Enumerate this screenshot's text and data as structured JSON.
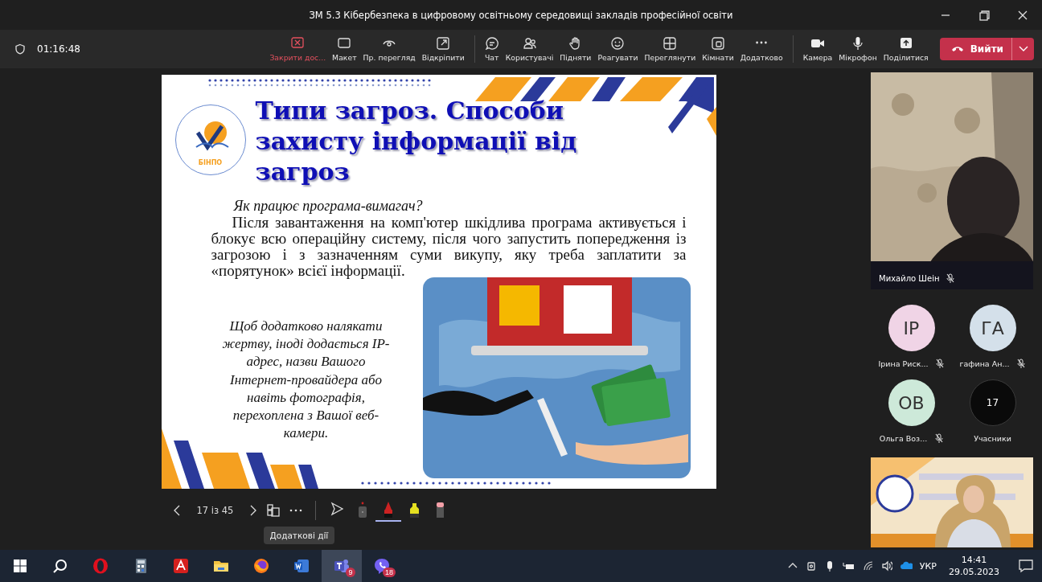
{
  "window": {
    "title": "ЗМ 5.3 Кібербезпека в цифровому освітньому середовищі закладів професійної освіти"
  },
  "meeting_toolbar": {
    "timer": "01:16:48",
    "buttons": [
      {
        "label": "Закрити дос...",
        "danger": true
      },
      {
        "label": "Макет",
        "danger": false
      },
      {
        "label": "Пр. перегляд",
        "danger": false
      },
      {
        "label": "Відкріпити",
        "danger": false
      },
      {
        "label": "Чат",
        "danger": false
      },
      {
        "label": "Користувачі",
        "danger": false
      },
      {
        "label": "Підняти",
        "danger": false
      },
      {
        "label": "Реагувати",
        "danger": false
      },
      {
        "label": "Переглянути",
        "danger": false
      },
      {
        "label": "Кімнати",
        "danger": false
      },
      {
        "label": "Додатково",
        "danger": false
      },
      {
        "label": "Камера",
        "danger": false
      },
      {
        "label": "Мікрофон",
        "danger": false
      },
      {
        "label": "Поділитися",
        "danger": false
      }
    ],
    "leave_button": {
      "label": "Вийти"
    }
  },
  "slide": {
    "logo_text": "БІНПО",
    "title": "Типи загроз. Способи захисту інформації від загроз",
    "question": "Як працює програма-вимагач?",
    "paragraph": "Після завантаження на комп'ютер шкідлива програма активується і блокує всю операційну систему, після чого запустить попередження із загрозою і з зазначенням суми викупу, яку треба заплатити за «порятунок» всієї інформації.",
    "side_text": "Щоб додатково налякати жертву, іноді додається IP-адрес, назви Вашого Інтернет-провайдера або навіть фотографія, перехоплена з Вашої веб-камери."
  },
  "slide_controls": {
    "counter": "17 із 45",
    "tooltip": "Додаткові дії",
    "tools": [
      {
        "kind": "pointer",
        "selected": false
      },
      {
        "kind": "laser",
        "selected": false
      },
      {
        "kind": "pen",
        "selected": true
      },
      {
        "kind": "highlighter",
        "selected": false
      },
      {
        "kind": "eraser",
        "selected": false
      }
    ]
  },
  "participants": {
    "main_video": {
      "kind": "picture",
      "name": "Михайло Шеін",
      "muted": true
    },
    "avatars": [
      {
        "initials": "ІР",
        "name": "Ірина Риск...",
        "color": "#f0d4e6",
        "muted": true
      },
      {
        "initials": "ГА",
        "name": "гафина Ан...",
        "color": "#d4e0ea",
        "muted": true
      },
      {
        "initials": "ОВ",
        "name": "Ольга Воз...",
        "color": "#cde9d9",
        "muted": true
      }
    ],
    "overflow": {
      "count": "17",
      "label": "Учасники"
    }
  },
  "taskbar": {
    "apps": [
      {
        "kind": "search",
        "active": false
      },
      {
        "kind": "opera",
        "active": false
      },
      {
        "kind": "calculator",
        "active": false
      },
      {
        "kind": "acrobat",
        "active": false
      },
      {
        "kind": "explorer",
        "active": false
      },
      {
        "kind": "firefox",
        "active": false
      },
      {
        "kind": "word",
        "active": false
      },
      {
        "kind": "teams",
        "active": true,
        "badge": "9"
      },
      {
        "kind": "viber",
        "active": false,
        "badge": "18"
      }
    ],
    "language": "УКР",
    "time": "14:41",
    "date": "29.05.2023"
  }
}
